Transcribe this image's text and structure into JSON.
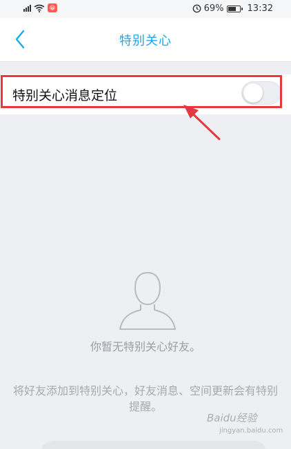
{
  "status_bar": {
    "battery_percent": "69%",
    "battery_level": 0.69,
    "time": "13:32",
    "app_badge": "😀"
  },
  "header": {
    "title": "特别关心",
    "back_icon": "chevron-left-icon"
  },
  "setting": {
    "label": "特别关心消息定位",
    "enabled": false
  },
  "empty_state": {
    "icon": "person-outline-icon",
    "title": "你暂无特别关心好友。",
    "description": "将好友添加到特别关心，好友消息、空间更新会有特别提醒。"
  },
  "watermark": {
    "text": "Baidu经验",
    "sub": "jingyan.baidu.com"
  },
  "colors": {
    "accent": "#1aa8f0",
    "highlight": "#e5383f",
    "background": "#eeeff3"
  }
}
